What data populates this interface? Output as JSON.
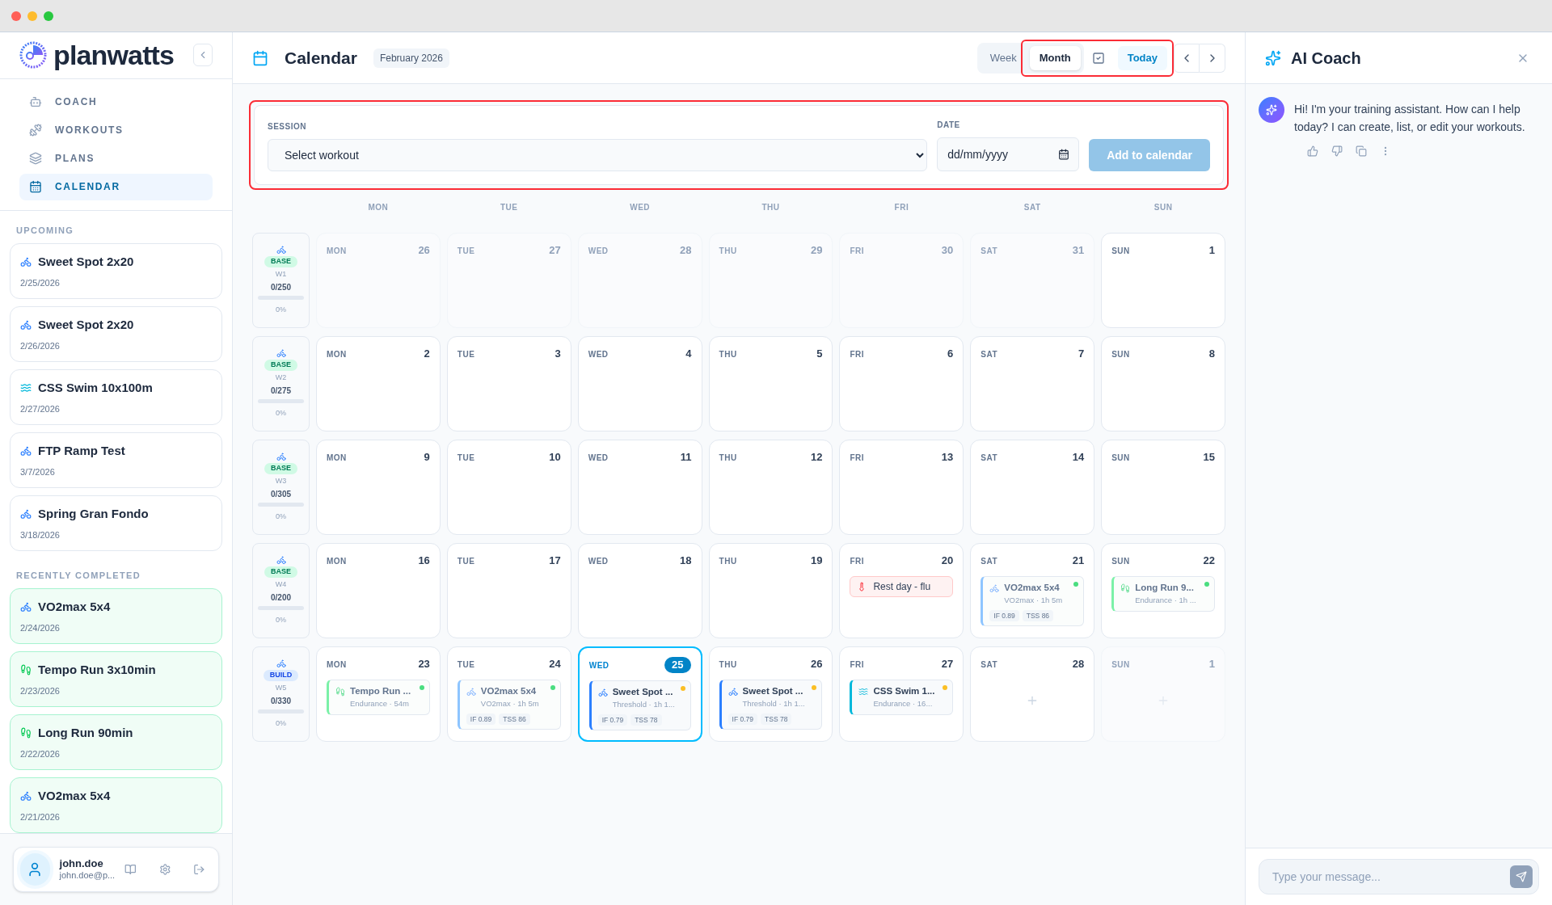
{
  "brand": {
    "name": "planwatts"
  },
  "nav": [
    {
      "label": "COACH",
      "kind": "coach",
      "selected": false
    },
    {
      "label": "WORKOUTS",
      "kind": "workouts",
      "selected": false
    },
    {
      "label": "PLANS",
      "kind": "plans",
      "selected": false
    },
    {
      "label": "CALENDAR",
      "kind": "calendar",
      "selected": true
    }
  ],
  "upcoming": {
    "title": "UPCOMING",
    "completed": false,
    "items": [
      {
        "title": "Sweet Spot 2x20",
        "date": "2/25/2026",
        "kind": "bike"
      },
      {
        "title": "Sweet Spot 2x20",
        "date": "2/26/2026",
        "kind": "bike"
      },
      {
        "title": "CSS Swim 10x100m",
        "date": "2/27/2026",
        "kind": "swim"
      },
      {
        "title": "FTP Ramp Test",
        "date": "3/7/2026",
        "kind": "bike"
      },
      {
        "title": "Spring Gran Fondo",
        "date": "3/18/2026",
        "kind": "bike"
      }
    ]
  },
  "recent": {
    "title": "RECENTLY COMPLETED",
    "completed": true,
    "items": [
      {
        "title": "VO2max 5x4",
        "date": "2/24/2026",
        "kind": "bike"
      },
      {
        "title": "Tempo Run 3x10min",
        "date": "2/23/2026",
        "kind": "run"
      },
      {
        "title": "Long Run 90min",
        "date": "2/22/2026",
        "kind": "run"
      },
      {
        "title": "VO2max 5x4",
        "date": "2/21/2026",
        "kind": "bike"
      }
    ]
  },
  "user": {
    "name": "john.doe",
    "email": "john.doe@p..."
  },
  "header": {
    "title": "Calendar",
    "period": "February 2026",
    "views": [
      {
        "label": "Week",
        "selected": false
      },
      {
        "label": "Month",
        "selected": true
      }
    ],
    "today": "Today",
    "highlighted": true
  },
  "form": {
    "session_label": "SESSION",
    "session_value": "Select workout",
    "date_label": "DATE",
    "date_placeholder": "dd/mm/yyyy",
    "submit": "Add to calendar",
    "disabled": true,
    "highlighted": true
  },
  "weekdays": [
    "MON",
    "TUE",
    "WED",
    "THU",
    "FRI",
    "SAT",
    "SUN"
  ],
  "weeks": [
    {
      "phase": "BASE",
      "kind": "base",
      "week": "W1",
      "load": "0/250",
      "percent": "0%",
      "days": [
        {
          "dow": "MON",
          "date": "26",
          "muted": true
        },
        {
          "dow": "TUE",
          "date": "27",
          "muted": true
        },
        {
          "dow": "WED",
          "date": "28",
          "muted": true
        },
        {
          "dow": "THU",
          "date": "29",
          "muted": true
        },
        {
          "dow": "FRI",
          "date": "30",
          "muted": true
        },
        {
          "dow": "SAT",
          "date": "31",
          "muted": true
        },
        {
          "dow": "SUN",
          "date": "1",
          "muted": false
        }
      ]
    },
    {
      "phase": "BASE",
      "kind": "base",
      "week": "W2",
      "load": "0/275",
      "percent": "0%",
      "days": [
        {
          "dow": "MON",
          "date": "2",
          "muted": false
        },
        {
          "dow": "TUE",
          "date": "3",
          "muted": false
        },
        {
          "dow": "WED",
          "date": "4",
          "muted": false
        },
        {
          "dow": "THU",
          "date": "5",
          "muted": false
        },
        {
          "dow": "FRI",
          "date": "6",
          "muted": false
        },
        {
          "dow": "SAT",
          "date": "7",
          "muted": false
        },
        {
          "dow": "SUN",
          "date": "8",
          "muted": false
        }
      ]
    },
    {
      "phase": "BASE",
      "kind": "base",
      "week": "W3",
      "load": "0/305",
      "percent": "0%",
      "days": [
        {
          "dow": "MON",
          "date": "9",
          "muted": false
        },
        {
          "dow": "TUE",
          "date": "10",
          "muted": false
        },
        {
          "dow": "WED",
          "date": "11",
          "muted": false
        },
        {
          "dow": "THU",
          "date": "12",
          "muted": false
        },
        {
          "dow": "FRI",
          "date": "13",
          "muted": false
        },
        {
          "dow": "SAT",
          "date": "14",
          "muted": false
        },
        {
          "dow": "SUN",
          "date": "15",
          "muted": false
        }
      ]
    },
    {
      "phase": "BASE",
      "kind": "base",
      "week": "W4",
      "load": "0/200",
      "percent": "0%",
      "days": [
        {
          "dow": "MON",
          "date": "16",
          "muted": false
        },
        {
          "dow": "TUE",
          "date": "17",
          "muted": false
        },
        {
          "dow": "WED",
          "date": "18",
          "muted": false
        },
        {
          "dow": "THU",
          "date": "19",
          "muted": false
        },
        {
          "dow": "FRI",
          "date": "20",
          "muted": false,
          "events": [
            {
              "kind": "note",
              "title": "Rest day - flu"
            }
          ]
        },
        {
          "dow": "SAT",
          "date": "21",
          "muted": false,
          "events": [
            {
              "kind": "bike",
              "title": "VO2max 5x4",
              "subtitle": "VO2max · 1h 5m",
              "if": "IF 0.89",
              "tss": "TSS 86",
              "completed": true,
              "color": "#4ade80"
            }
          ]
        },
        {
          "dow": "SUN",
          "date": "22",
          "muted": false,
          "events": [
            {
              "kind": "run",
              "title": "Long Run 9...",
              "subtitle": "Endurance · 1h ...",
              "completed": true,
              "color": "#4ade80"
            }
          ]
        }
      ]
    },
    {
      "phase": "BUILD",
      "kind": "build",
      "week": "W5",
      "load": "0/330",
      "percent": "0%",
      "days": [
        {
          "dow": "MON",
          "date": "23",
          "muted": false,
          "events": [
            {
              "kind": "run",
              "title": "Tempo Run ...",
              "subtitle": "Endurance · 54m",
              "completed": true,
              "color": "#4ade80"
            }
          ]
        },
        {
          "dow": "TUE",
          "date": "24",
          "muted": false,
          "events": [
            {
              "kind": "bike",
              "title": "VO2max 5x4",
              "subtitle": "VO2max · 1h 5m",
              "if": "IF 0.89",
              "tss": "TSS 86",
              "completed": true,
              "color": "#4ade80"
            }
          ]
        },
        {
          "dow": "WED",
          "date": "25",
          "muted": false,
          "today": true,
          "events": [
            {
              "kind": "bike",
              "title": "Sweet Spot ...",
              "subtitle": "Threshold · 1h 1...",
              "if": "IF 0.79",
              "tss": "TSS 78",
              "completed": false,
              "color": "#fbbf24"
            }
          ]
        },
        {
          "dow": "THU",
          "date": "26",
          "muted": false,
          "events": [
            {
              "kind": "bike",
              "title": "Sweet Spot ...",
              "subtitle": "Threshold · 1h 1...",
              "if": "IF 0.79",
              "tss": "TSS 78",
              "completed": false,
              "color": "#fbbf24"
            }
          ]
        },
        {
          "dow": "FRI",
          "date": "27",
          "muted": false,
          "events": [
            {
              "kind": "swim",
              "title": "CSS Swim 1...",
              "subtitle": "Endurance · 16...",
              "completed": false,
              "color": "#fbbf24"
            }
          ]
        },
        {
          "dow": "SAT",
          "date": "28",
          "muted": false,
          "add_slot": true
        },
        {
          "dow": "SUN",
          "date": "1",
          "muted": true,
          "add_slot": true
        }
      ]
    }
  ],
  "coach": {
    "title": "AI Coach",
    "message": "Hi! I'm your training assistant. How can I help today? I can create, list, or edit your workouts.",
    "input_placeholder": "Type your message..."
  }
}
